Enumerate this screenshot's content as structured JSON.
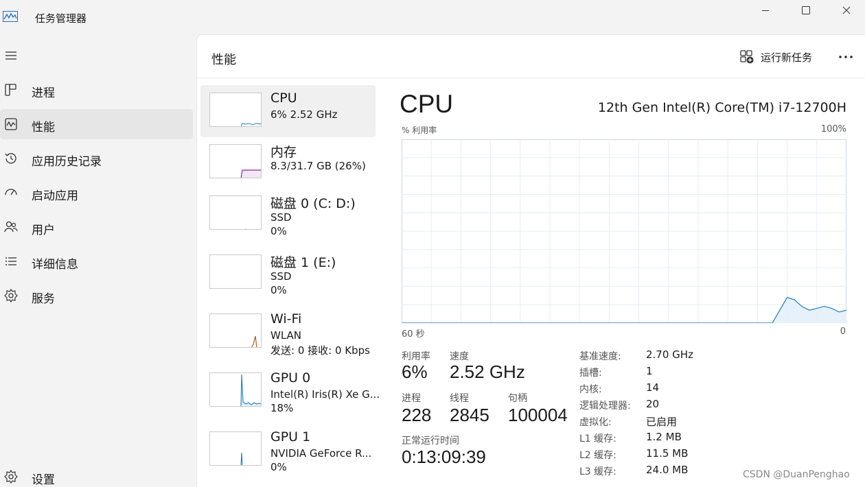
{
  "window": {
    "title": "任务管理器",
    "controls": [
      "minimize-icon",
      "maximize-icon",
      "close-icon"
    ]
  },
  "nav": {
    "items": [
      {
        "label": "进程",
        "icon": "processes-icon"
      },
      {
        "label": "性能",
        "icon": "performance-icon",
        "active": true
      },
      {
        "label": "应用历史记录",
        "icon": "history-icon"
      },
      {
        "label": "启动应用",
        "icon": "startup-icon"
      },
      {
        "label": "用户",
        "icon": "users-icon"
      },
      {
        "label": "详细信息",
        "icon": "details-icon"
      },
      {
        "label": "服务",
        "icon": "services-icon"
      }
    ],
    "settings": {
      "label": "设置",
      "icon": "gear-icon"
    }
  },
  "header": {
    "title": "性能",
    "run_task_label": "运行新任务"
  },
  "devices": [
    {
      "name": "CPU",
      "line1": "6%  2.52 GHz",
      "line2": "",
      "color": "#1b7fc4",
      "active": true
    },
    {
      "name": "内存",
      "line1": "8.3/31.7 GB (26%)",
      "line2": "",
      "color": "#8b2b9b"
    },
    {
      "name": "磁盘 0 (C: D:)",
      "line1": "SSD",
      "line2": "0%",
      "color": "#4a8c2a"
    },
    {
      "name": "磁盘 1 (E:)",
      "line1": "SSD",
      "line2": "0%",
      "color": "#4a8c2a"
    },
    {
      "name": "Wi-Fi",
      "line1": "WLAN",
      "line2": "发送: 0  接收: 0 Kbps",
      "color": "#b15c1e"
    },
    {
      "name": "GPU 0",
      "line1": "Intel(R) Iris(R) Xe G...",
      "line2": "18%",
      "color": "#1b7fc4"
    },
    {
      "name": "GPU 1",
      "line1": "NVIDIA GeForce R...",
      "line2": "0%",
      "color": "#1b7fc4"
    }
  ],
  "cpu": {
    "title": "CPU",
    "model": "12th Gen Intel(R) Core(TM) i7-12700H",
    "axis": {
      "y_label": "% 利用率",
      "y_max": "100%",
      "x_left": "60 秒",
      "x_right": "0"
    },
    "graph_color": "#1b7fc4",
    "stats": {
      "utilization_label": "利用率",
      "utilization": "6%",
      "speed_label": "速度",
      "speed": "2.52 GHz",
      "processes_label": "进程",
      "processes": "228",
      "threads_label": "线程",
      "threads": "2845",
      "handles_label": "句柄",
      "handles": "100004",
      "uptime_label": "正常运行时间",
      "uptime": "0:13:09:39"
    },
    "specs": [
      {
        "key": "基准速度:",
        "value": "2.70 GHz"
      },
      {
        "key": "插槽:",
        "value": "1"
      },
      {
        "key": "内核:",
        "value": "14"
      },
      {
        "key": "逻辑处理器:",
        "value": "20"
      },
      {
        "key": "虚拟化:",
        "value": "已启用"
      },
      {
        "key": "L1 缓存:",
        "value": "1.2 MB"
      },
      {
        "key": "L2 缓存:",
        "value": "11.5 MB"
      },
      {
        "key": "L3 缓存:",
        "value": "24.0 MB"
      }
    ]
  },
  "chart_data": {
    "type": "area",
    "title": "",
    "ylabel": "% 利用率",
    "xlabel": "",
    "ylim": [
      0,
      100
    ],
    "xlim": [
      60,
      0
    ],
    "grid": true,
    "x": [
      60,
      10,
      8,
      6,
      4,
      2,
      0
    ],
    "series": [
      {
        "values": [
          0,
          0,
          14,
          9,
          8,
          8,
          7
        ]
      }
    ]
  },
  "watermark": "CSDN @DuanPenghao"
}
